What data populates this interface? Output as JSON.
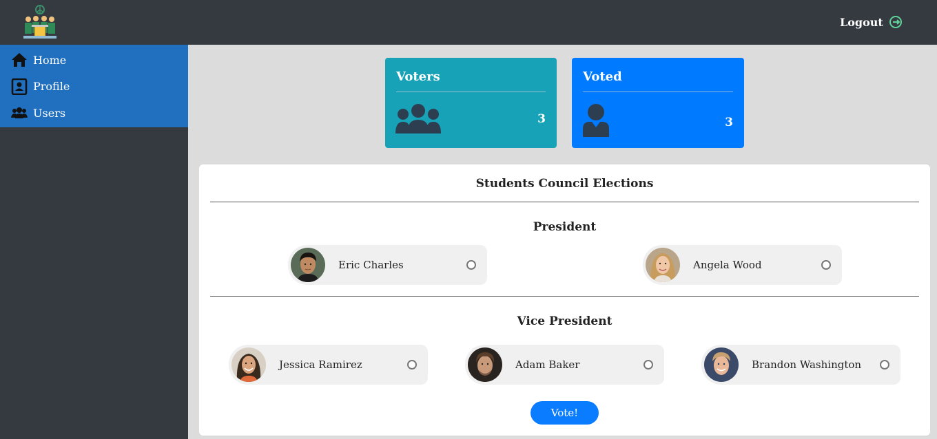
{
  "header": {
    "logout_label": "Logout",
    "logo_icon": "election-podium-logo",
    "logout_icon": "logout-icon"
  },
  "sidebar": {
    "items": [
      {
        "label": "Home",
        "icon": "home-icon"
      },
      {
        "label": "Profile",
        "icon": "profile-card-icon"
      },
      {
        "label": "Users",
        "icon": "users-icon"
      }
    ]
  },
  "stats": {
    "voters": {
      "title": "Voters",
      "count": "3",
      "icon": "group-icon",
      "color": "#17a2b8"
    },
    "voted": {
      "title": "Voted",
      "count": "3",
      "icon": "person-icon",
      "color": "#007bff"
    }
  },
  "election": {
    "title": "Students Council Elections",
    "positions": [
      {
        "title": "President",
        "candidates": [
          {
            "name": "Eric Charles"
          },
          {
            "name": "Angela Wood"
          }
        ]
      },
      {
        "title": "Vice President",
        "candidates": [
          {
            "name": "Jessica Ramirez"
          },
          {
            "name": "Adam Baker"
          },
          {
            "name": "Brandon Washington"
          }
        ]
      }
    ],
    "vote_label": "Vote!"
  }
}
